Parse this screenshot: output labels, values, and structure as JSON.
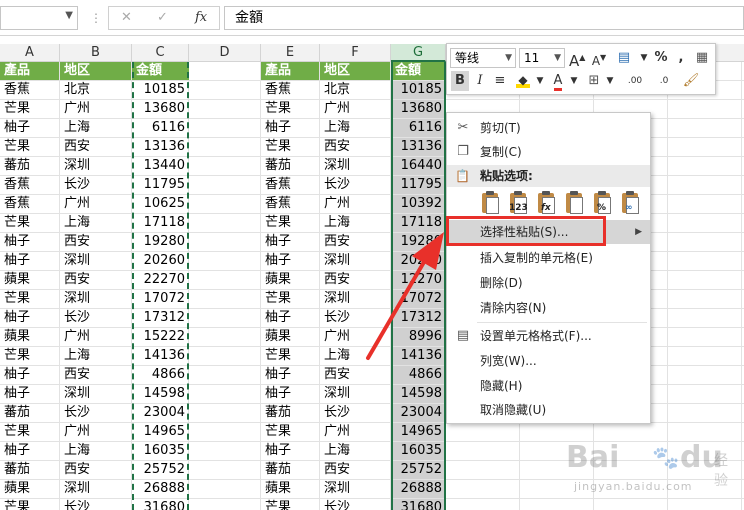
{
  "formula_bar": {
    "namebox_value": "",
    "fx_label": "fx",
    "cancel_symbol": "✕",
    "confirm_symbol": "✓",
    "content": "金額"
  },
  "columns": [
    "A",
    "B",
    "C",
    "D",
    "E",
    "F",
    "G"
  ],
  "table_headers": {
    "product": "產品",
    "region": "地区",
    "amount": "金額"
  },
  "rows": [
    {
      "p": "香蕉",
      "r": "北京",
      "a": "10185",
      "g": "10185"
    },
    {
      "p": "芒果",
      "r": "广州",
      "a": "13680",
      "g": "13680"
    },
    {
      "p": "柚子",
      "r": "上海",
      "a": "6116",
      "g": "6116"
    },
    {
      "p": "芒果",
      "r": "西安",
      "a": "13136",
      "g": "13136"
    },
    {
      "p": "蕃茄",
      "r": "深圳",
      "a": "13440",
      "g": "16440"
    },
    {
      "p": "香蕉",
      "r": "长沙",
      "a": "11795",
      "g": "11795"
    },
    {
      "p": "香蕉",
      "r": "广州",
      "a": "10625",
      "g": "10392"
    },
    {
      "p": "芒果",
      "r": "上海",
      "a": "17118",
      "g": "17118"
    },
    {
      "p": "柚子",
      "r": "西安",
      "a": "19280",
      "g": "19280"
    },
    {
      "p": "柚子",
      "r": "深圳",
      "a": "20260",
      "g": "20260"
    },
    {
      "p": "蘋果",
      "r": "西安",
      "a": "22270",
      "g": "12270"
    },
    {
      "p": "芒果",
      "r": "深圳",
      "a": "17072",
      "g": "17072"
    },
    {
      "p": "柚子",
      "r": "长沙",
      "a": "17312",
      "g": "17312"
    },
    {
      "p": "蘋果",
      "r": "广州",
      "a": "15222",
      "g": "8996"
    },
    {
      "p": "芒果",
      "r": "上海",
      "a": "14136",
      "g": "14136"
    },
    {
      "p": "柚子",
      "r": "西安",
      "a": "4866",
      "g": "4866"
    },
    {
      "p": "柚子",
      "r": "深圳",
      "a": "14598",
      "g": "14598"
    },
    {
      "p": "蕃茄",
      "r": "长沙",
      "a": "23004",
      "g": "23004"
    },
    {
      "p": "芒果",
      "r": "广州",
      "a": "14965",
      "g": "14965"
    },
    {
      "p": "柚子",
      "r": "上海",
      "a": "16035",
      "g": "16035"
    },
    {
      "p": "蕃茄",
      "r": "西安",
      "a": "25752",
      "g": "25752"
    },
    {
      "p": "蘋果",
      "r": "深圳",
      "a": "26888",
      "g": "26888"
    },
    {
      "p": "芒果",
      "r": "长沙",
      "a": "31680",
      "g": "31680"
    }
  ],
  "mini_toolbar": {
    "font_name": "等线",
    "font_size": "11",
    "increase_font": "A",
    "decrease_font": "A",
    "percent": "%",
    "comma": ",",
    "bold": "B",
    "italic": "I",
    "font_color_letter": "A",
    "increase_decimal": ".00",
    "decrease_decimal": ".0"
  },
  "context_menu": {
    "cut": "剪切(T)",
    "copy": "复制(C)",
    "paste_options": "粘贴选项:",
    "paste_special": "选择性粘贴(S)...",
    "insert_copied": "插入复制的单元格(E)",
    "delete": "删除(D)",
    "clear": "清除内容(N)",
    "format_cells": "设置单元格格式(F)...",
    "column_width": "列宽(W)...",
    "hide": "隐藏(H)",
    "unhide": "取消隐藏(U)",
    "paste_icon_labels": [
      "",
      "123",
      "fx",
      "",
      "%",
      ""
    ]
  },
  "watermark": {
    "brand": "Bai",
    "paw": "du",
    "suffix": "经验",
    "site": "jingyan.baidu.com"
  },
  "colors": {
    "header_green": "#70ad47",
    "selection_green": "#217346",
    "highlight_red": "#e8302a"
  }
}
